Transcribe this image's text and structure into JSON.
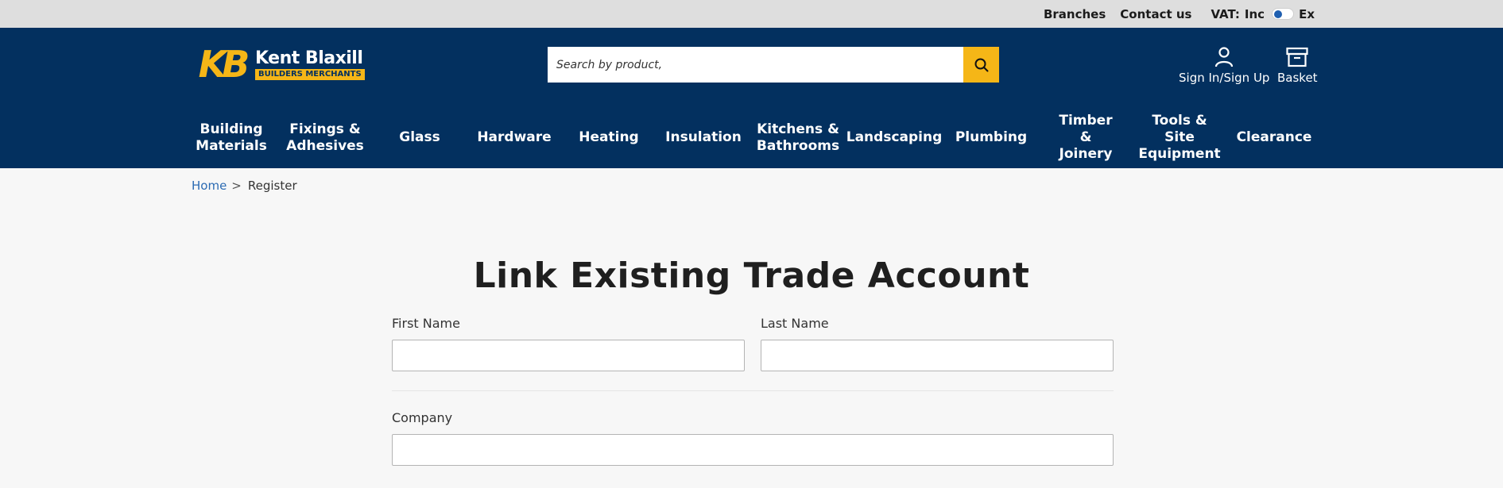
{
  "topbar": {
    "branches": "Branches",
    "contact": "Contact us",
    "vat_label": "VAT:",
    "vat_inc": "Inc",
    "vat_ex": "Ex"
  },
  "header": {
    "logo_mark": "KB",
    "logo_name": "Kent Blaxill",
    "logo_sub": "BUILDERS MERCHANTS",
    "search_placeholder": "Search by product,",
    "signin_label": "Sign In/Sign Up",
    "basket_label": "Basket"
  },
  "nav": {
    "items": [
      {
        "label": "Building\nMaterials"
      },
      {
        "label": "Fixings &\nAdhesives"
      },
      {
        "label": "Glass"
      },
      {
        "label": "Hardware"
      },
      {
        "label": "Heating"
      },
      {
        "label": "Insulation"
      },
      {
        "label": "Kitchens &\nBathrooms"
      },
      {
        "label": "Landscaping"
      },
      {
        "label": "Plumbing"
      },
      {
        "label": "Timber\n&\nJoinery"
      },
      {
        "label": "Tools &\nSite\nEquipment"
      },
      {
        "label": "Clearance"
      }
    ]
  },
  "breadcrumb": {
    "home": "Home",
    "separator": ">",
    "current": "Register"
  },
  "form": {
    "title": "Link Existing Trade Account",
    "first_name_label": "First Name",
    "last_name_label": "Last Name",
    "company_label": "Company",
    "first_name_value": "",
    "last_name_value": "",
    "company_value": ""
  },
  "colors": {
    "brand_navy": "#03305f",
    "brand_yellow": "#f5b617",
    "link_blue": "#2c6bb3"
  }
}
